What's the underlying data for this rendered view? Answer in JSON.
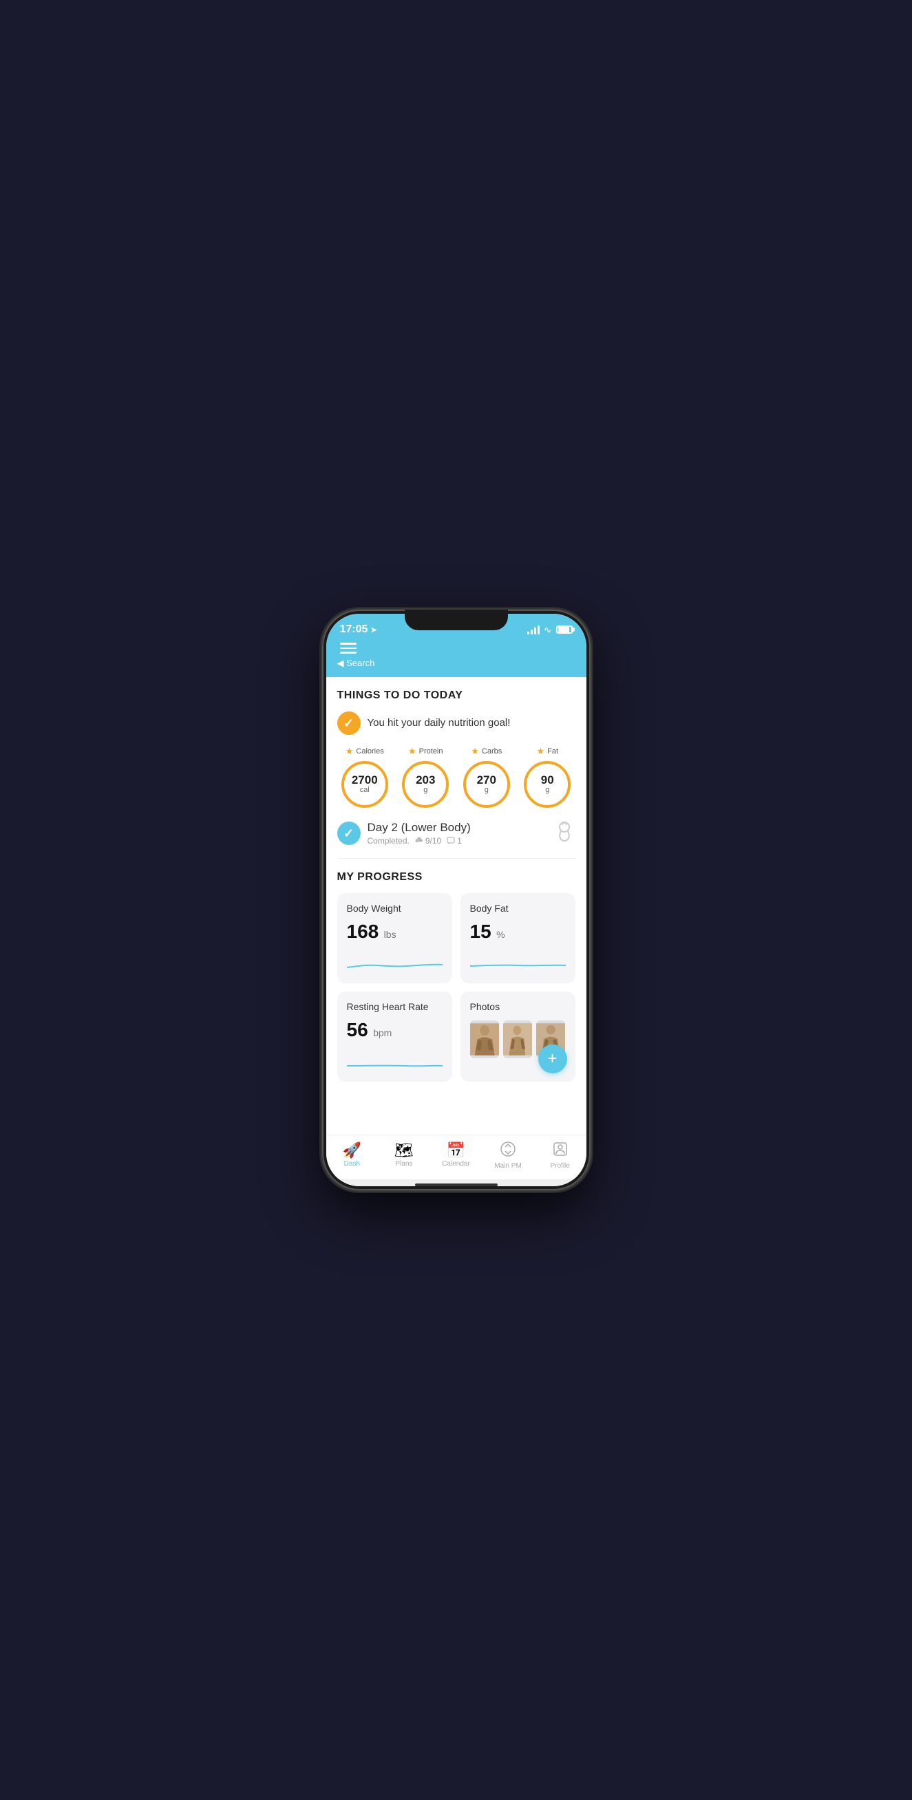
{
  "status": {
    "time": "17:05",
    "back_label": "◀ Search",
    "location_arrow": "➤"
  },
  "header": {
    "menu_label": "Menu"
  },
  "things_to_do": {
    "section_title": "THINGS TO DO TODAY",
    "goal_message": "You hit your daily nutrition goal!",
    "nutrition": {
      "items": [
        {
          "label": "Calories",
          "value": "2700",
          "unit": "cal"
        },
        {
          "label": "Protein",
          "value": "203",
          "unit": "g"
        },
        {
          "label": "Carbs",
          "value": "270",
          "unit": "g"
        },
        {
          "label": "Fat",
          "value": "90",
          "unit": "g"
        }
      ]
    },
    "workout": {
      "title": "Day 2 (Lower Body)",
      "status": "Completed.",
      "rating": "9/10",
      "comments": "1"
    }
  },
  "my_progress": {
    "section_title": "MY PROGRESS",
    "cards": [
      {
        "title": "Body Weight",
        "value": "168",
        "unit": "lbs"
      },
      {
        "title": "Body Fat",
        "value": "15",
        "unit": "%"
      },
      {
        "title": "Resting Heart Rate",
        "value": "56",
        "unit": "bpm"
      },
      {
        "title": "Photos",
        "value": "",
        "unit": ""
      }
    ],
    "photos_count": 3
  },
  "bottom_nav": {
    "items": [
      {
        "icon": "🚀",
        "label": "Dash",
        "active": true
      },
      {
        "icon": "🗺",
        "label": "Plans",
        "active": false
      },
      {
        "icon": "📅",
        "label": "Calendar",
        "active": false
      },
      {
        "icon": "💬",
        "label": "Main PM",
        "active": false
      },
      {
        "icon": "👤",
        "label": "Profile",
        "active": false
      }
    ]
  },
  "fab": {
    "label": "+"
  }
}
